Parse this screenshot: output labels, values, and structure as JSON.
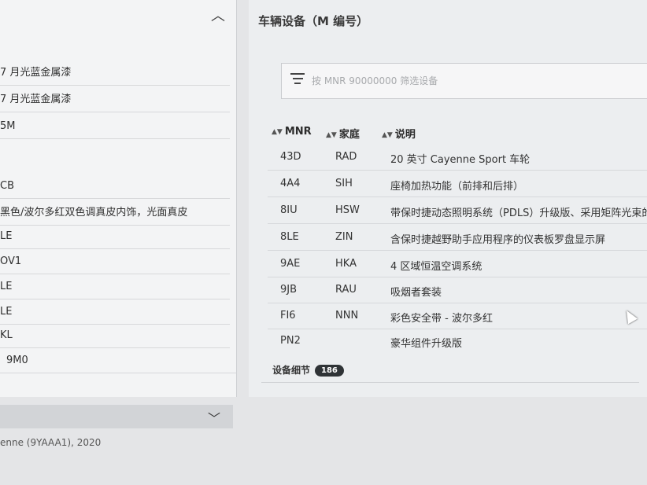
{
  "left_panel": {
    "rows": [
      "7 月光蓝金属漆",
      "7 月光蓝金属漆",
      "5M",
      "",
      "CB",
      "黑色/波尔多红双色调真皮内饰，光面真皮",
      "LE",
      "OV1",
      "LE",
      "LE",
      "KL",
      "9M0"
    ],
    "model_line": "enne (9YAAA1), 2020"
  },
  "right_panel": {
    "title": "车辆设备（M 编号）",
    "filter_placeholder": "按 MNR 90000000 筛选设备",
    "columns": {
      "mnr": "MNR",
      "family": "家庭",
      "description": "说明"
    },
    "rows": [
      {
        "mnr": "43D",
        "family": "RAD",
        "description": "20 英寸 Cayenne Sport 车轮"
      },
      {
        "mnr": "4A4",
        "family": "SIH",
        "description": "座椅加热功能（前排和后排）"
      },
      {
        "mnr": "8IU",
        "family": "HSW",
        "description": "带保时捷动态照明系统（PDLS）升级版、采用矩阵光束的"
      },
      {
        "mnr": "8LE",
        "family": "ZIN",
        "description": "含保时捷越野助手应用程序的仪表板罗盘显示屏"
      },
      {
        "mnr": "9AE",
        "family": "HKA",
        "description": "4 区域恒温空调系统"
      },
      {
        "mnr": "9JB",
        "family": "RAU",
        "description": "吸烟者套装"
      },
      {
        "mnr": "FI6",
        "family": "NNN",
        "description": "彩色安全带 - 波尔多红"
      },
      {
        "mnr": "PN2",
        "family": "",
        "description": "豪华组件升级版"
      }
    ],
    "details_label": "设备细节",
    "details_count": "186"
  },
  "icons": [
    "chevron-up-icon",
    "chevron-down-icon",
    "filter-icon",
    "sort-icon",
    "mouse-cursor-icon"
  ]
}
